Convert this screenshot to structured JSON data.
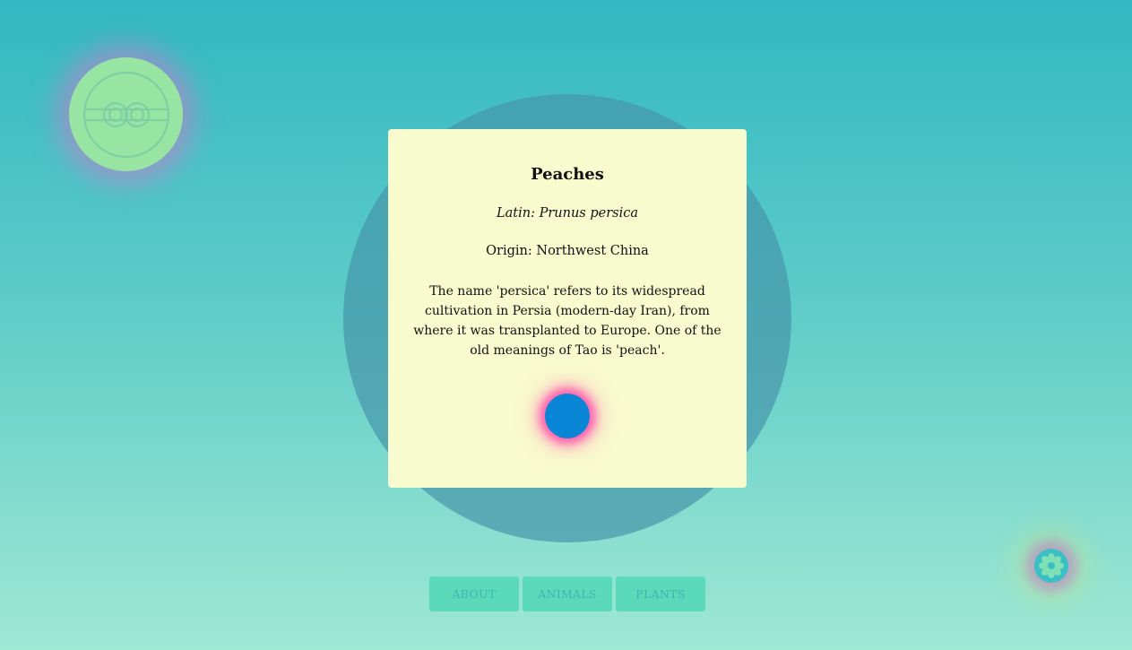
{
  "card": {
    "title": "Peaches",
    "latin": "Latin: Prunus persica",
    "origin": "Origin: Northwest China",
    "description": "The name 'persica' refers to its widespread cultivation in Persia (modern-day Iran), from where it was transplanted to Europe. One of the old meanings of Tao is 'peach'."
  },
  "nav": {
    "items": [
      {
        "label": "ABOUT"
      },
      {
        "label": "ANIMALS"
      },
      {
        "label": "PLANTS"
      }
    ]
  },
  "icons": {
    "logo": "endless-knot-icon",
    "flower": "flower-icon",
    "dot": "circle-dot-icon"
  },
  "colors": {
    "background_top": "#33b8c3",
    "background_bottom": "#9fe8d4",
    "card_background": "#f8fbcd",
    "dot": "#0a86d6",
    "glow": "#ff5fb0",
    "nav_button": "#5bdabb",
    "logo_badge": "#98e5a3"
  }
}
